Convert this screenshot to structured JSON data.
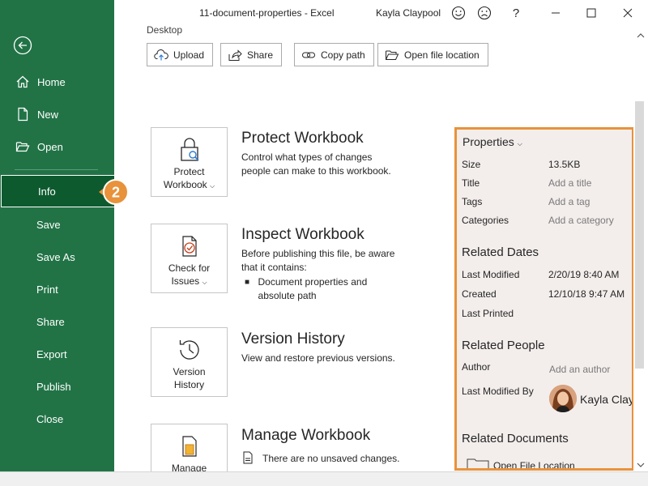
{
  "window": {
    "title": "11-document-properties  -  Excel",
    "user": "Kayla Claypool"
  },
  "sidebar": {
    "items": [
      {
        "label": "Home"
      },
      {
        "label": "New"
      },
      {
        "label": "Open"
      },
      {
        "label": "Info"
      },
      {
        "label": "Save"
      },
      {
        "label": "Save As"
      },
      {
        "label": "Print"
      },
      {
        "label": "Share"
      },
      {
        "label": "Export"
      },
      {
        "label": "Publish"
      },
      {
        "label": "Close"
      }
    ],
    "callout": "2"
  },
  "main": {
    "location": "Desktop",
    "actions": [
      {
        "label": "Upload",
        "icon": "upload-icon"
      },
      {
        "label": "Share",
        "icon": "share-icon"
      },
      {
        "label": "Copy path",
        "icon": "link-icon"
      },
      {
        "label": "Open file location",
        "icon": "folder-icon"
      }
    ],
    "sections": {
      "protect": {
        "btn_line1": "Protect",
        "btn_line2": "Workbook",
        "title": "Protect Workbook",
        "desc": "Control what types of changes people can make to this workbook."
      },
      "inspect": {
        "btn_line1": "Check for",
        "btn_line2": "Issues",
        "title": "Inspect Workbook",
        "desc": "Before publishing this file, be aware that it contains:",
        "bullets": [
          "Document properties and absolute path"
        ]
      },
      "version": {
        "btn_line1": "Version",
        "btn_line2": "History",
        "title": "Version History",
        "desc": "View and restore previous versions."
      },
      "manage": {
        "btn_line1": "Manage",
        "title": "Manage Workbook",
        "desc": "There are no unsaved changes."
      }
    }
  },
  "properties": {
    "header": "Properties",
    "rows": [
      {
        "label": "Size",
        "value": "13.5KB"
      },
      {
        "label": "Title",
        "value": "Add a title"
      },
      {
        "label": "Tags",
        "value": "Add a tag"
      },
      {
        "label": "Categories",
        "value": "Add a category"
      }
    ],
    "dates_header": "Related Dates",
    "dates": [
      {
        "label": "Last Modified",
        "value": "2/20/19 8:40 AM"
      },
      {
        "label": "Created",
        "value": "12/10/18 9:47 AM"
      },
      {
        "label": "Last Printed",
        "value": ""
      }
    ],
    "people_header": "Related People",
    "author_label": "Author",
    "author_placeholder": "Add an author",
    "last_modified_by_label": "Last Modified By",
    "last_modified_by": "Kayla Clay",
    "docs_header": "Related Documents",
    "open_location": "Open File Location"
  },
  "colors": {
    "accent": "#217346",
    "highlight": "#e8923b"
  }
}
